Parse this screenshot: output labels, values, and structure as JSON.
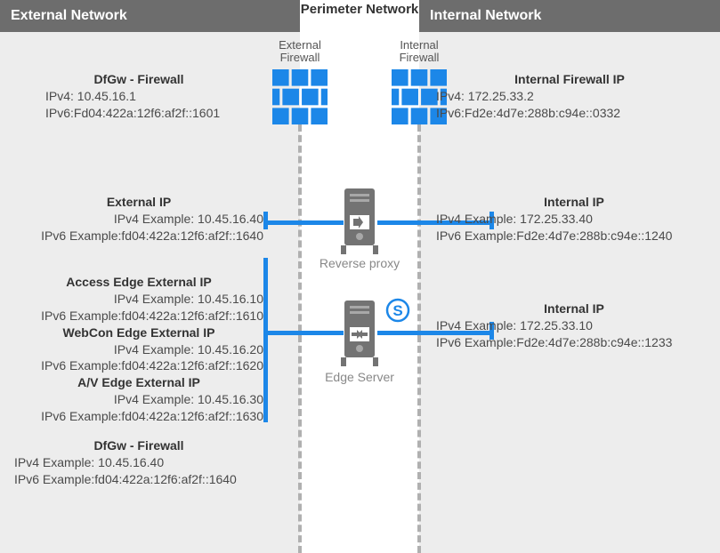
{
  "headers": {
    "external": "External Network",
    "perimeter": "Perimeter Network",
    "internal": "Internal Network"
  },
  "fw_labels": {
    "external": "External Firewall",
    "internal": "Internal Firewall"
  },
  "dfgw_top": {
    "title": "DfGw - Firewall",
    "ipv4": "IPv4: 10.45.16.1",
    "ipv6": "IPv6:Fd04:422a:12f6:af2f::1601"
  },
  "int_fw": {
    "title": "Internal Firewall IP",
    "ipv4": "IPv4: 172.25.33.2",
    "ipv6": "IPv6:Fd2e:4d7e:288b:c94e::0332"
  },
  "ext_ip": {
    "title": "External IP",
    "ipv4": "IPv4 Example: 10.45.16.40",
    "ipv6": "IPv6 Example:fd04:422a:12f6:af2f::1640"
  },
  "int_ip_rp": {
    "title": "Internal IP",
    "ipv4": "IPv4 Example: 172.25.33.40",
    "ipv6": "IPv6 Example:Fd2e:4d7e:288b:c94e::1240"
  },
  "edge": {
    "access": {
      "title": "Access Edge External IP",
      "ipv4": "IPv4 Example: 10.45.16.10",
      "ipv6": "IPv6 Example:fd04:422a:12f6:af2f::1610"
    },
    "webcon": {
      "title": "WebCon Edge External IP",
      "ipv4": "IPv4 Example: 10.45.16.20",
      "ipv6": "IPv6 Example:fd04:422a:12f6:af2f::1620"
    },
    "av": {
      "title": "A/V Edge External IP",
      "ipv4": "IPv4 Example: 10.45.16.30",
      "ipv6": "IPv6 Example:fd04:422a:12f6:af2f::1630"
    }
  },
  "int_ip_es": {
    "title": "Internal IP",
    "ipv4": "IPv4 Example: 172.25.33.10",
    "ipv6": "IPv6 Example:Fd2e:4d7e:288b:c94e::1233"
  },
  "dfgw_bot": {
    "title": "DfGw - Firewall",
    "ipv4": "IPv4 Example: 10.45.16.40",
    "ipv6": "IPv6 Example:fd04:422a:12f6:af2f::1640"
  },
  "captions": {
    "reverse_proxy": "Reverse proxy",
    "edge_server": "Edge Server"
  }
}
